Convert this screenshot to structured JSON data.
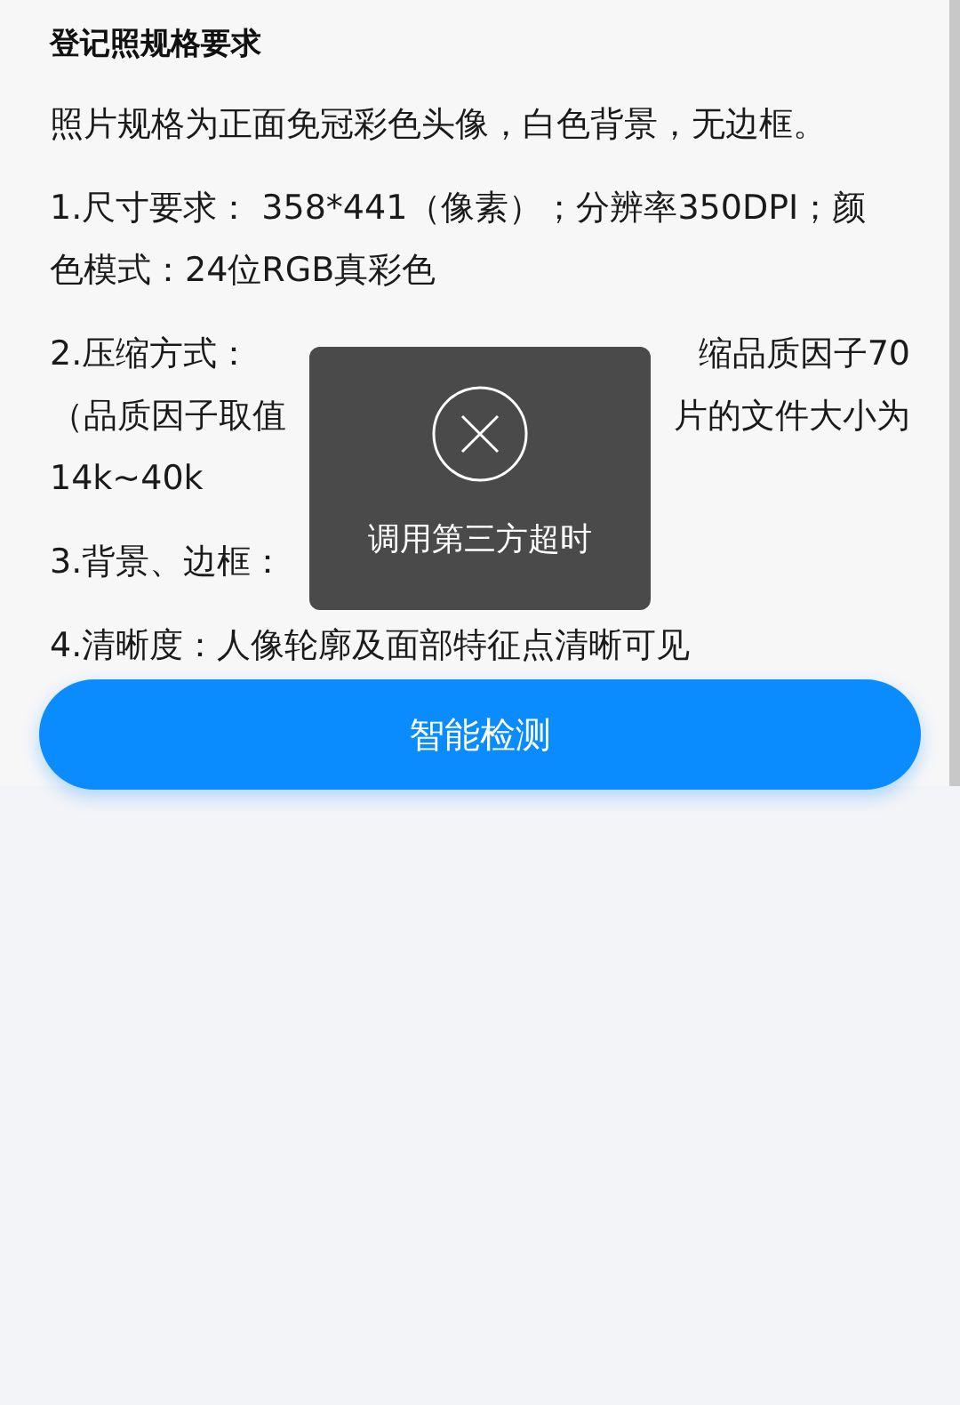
{
  "title": "登记照规格要求",
  "paragraphs": [
    {
      "lines": [
        {
          "segments": [
            "照片规格为正面免冠彩色头像，白色背景，无边框。"
          ]
        }
      ]
    },
    {
      "lines": [
        {
          "segments": [
            "1.尺寸要求： 358*441（像素）；分辨率350DPI；颜"
          ]
        },
        {
          "segments": [
            "色模式：24位RGB真彩色"
          ]
        }
      ]
    },
    {
      "lines": [
        {
          "segments": [
            "2.压缩方式：",
            "缩品质因子70"
          ]
        },
        {
          "segments": [
            "（品质因子取值",
            "片的文件大小为"
          ]
        },
        {
          "segments": [
            "14k~40k"
          ]
        }
      ]
    },
    {
      "lines": [
        {
          "segments": [
            "3.背景、边框："
          ]
        }
      ]
    },
    {
      "lines": [
        {
          "segments": [
            "4.清晰度：人像轮廓及面部特征点清晰可见"
          ]
        }
      ]
    }
  ],
  "button": "智能检测",
  "toast": {
    "message": "调用第三方超时"
  }
}
